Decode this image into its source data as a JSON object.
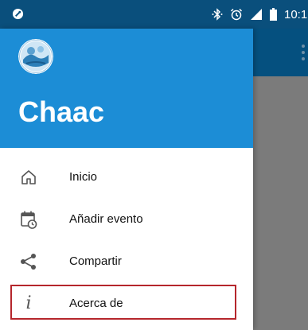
{
  "status_bar": {
    "time": "10:1",
    "icons": [
      "app-notification-icon",
      "bluetooth-icon",
      "alarm-icon",
      "signal-icon",
      "battery-icon"
    ]
  },
  "drawer": {
    "app_name": "Chaac",
    "avatar_icon": "app-logo",
    "menu": [
      {
        "label": "Inicio",
        "icon": "home-icon"
      },
      {
        "label": "Añadir evento",
        "icon": "calendar-add-icon"
      },
      {
        "label": "Compartir",
        "icon": "share-icon"
      },
      {
        "label": "Acerca de",
        "icon": "info-icon",
        "highlighted": true
      }
    ]
  },
  "colors": {
    "status_bar": "#0a4f7c",
    "toolbar": "#05507f",
    "drawer_header": "#1c8dd6",
    "scrim": "#7b7b7b",
    "highlight_border": "#b5262c"
  }
}
